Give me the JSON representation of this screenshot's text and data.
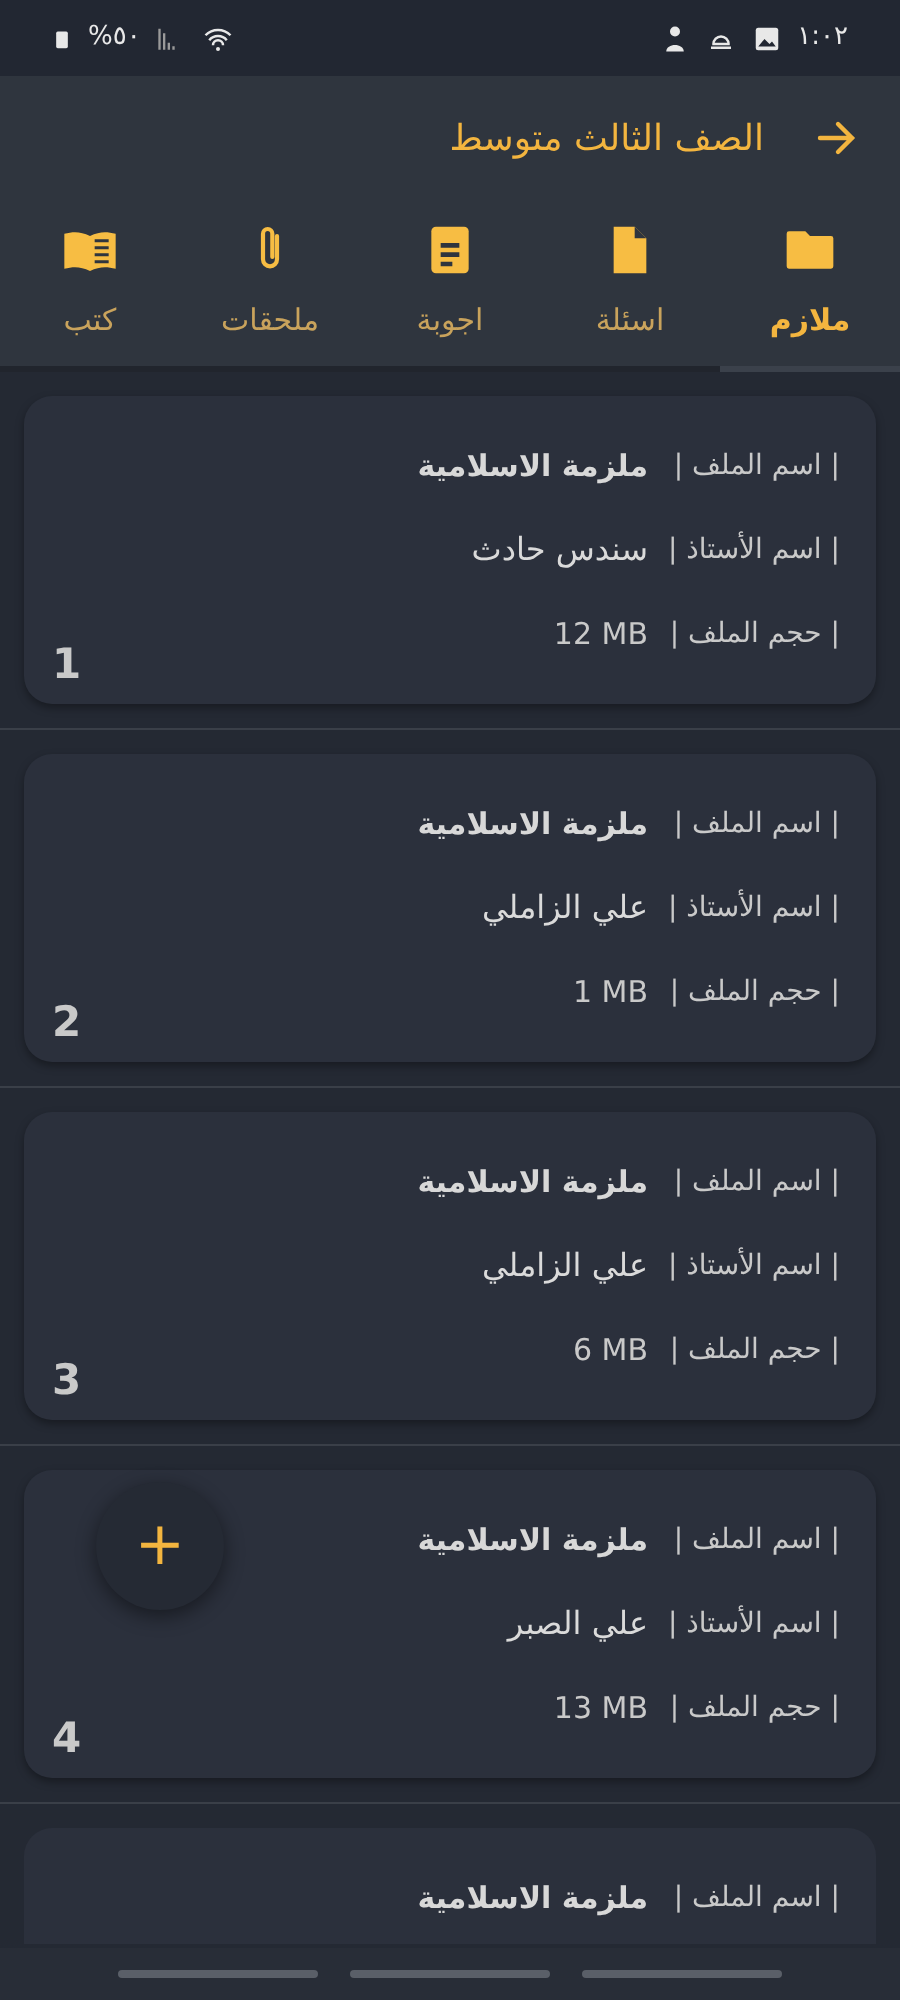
{
  "status_bar": {
    "time": "١:٠٢",
    "battery": "%٥٠"
  },
  "app_bar": {
    "title": "الصف الثالث متوسط"
  },
  "tabs": [
    {
      "label": "ملازم",
      "kind": "folder",
      "selected": true
    },
    {
      "label": "اسئلة",
      "kind": "file",
      "selected": false
    },
    {
      "label": "اجوبة",
      "kind": "document",
      "selected": false
    },
    {
      "label": "ملحقات",
      "kind": "paperclip",
      "selected": false
    },
    {
      "label": "كتب",
      "kind": "book",
      "selected": false
    }
  ],
  "files": [
    {
      "number": "1",
      "fields": [
        {
          "label": "| اسم الملف |",
          "value": "ملزمة الاسلامية",
          "kind": "name"
        },
        {
          "label": "| اسم الأستاذ |",
          "value": "سندس حادث",
          "kind": "teacher"
        },
        {
          "label": "| حجم الملف |",
          "value": "12 MB",
          "kind": "size"
        }
      ]
    },
    {
      "number": "2",
      "fields": [
        {
          "label": "| اسم الملف |",
          "value": "ملزمة الاسلامية",
          "kind": "name"
        },
        {
          "label": "| اسم الأستاذ |",
          "value": "علي الزاملي",
          "kind": "teacher"
        },
        {
          "label": "| حجم الملف |",
          "value": "1 MB",
          "kind": "size"
        }
      ]
    },
    {
      "number": "3",
      "fields": [
        {
          "label": "| اسم الملف |",
          "value": "ملزمة الاسلامية",
          "kind": "name"
        },
        {
          "label": "| اسم الأستاذ |",
          "value": "علي الزاملي",
          "kind": "teacher"
        },
        {
          "label": "| حجم الملف |",
          "value": "6 MB",
          "kind": "size"
        }
      ]
    },
    {
      "number": "4",
      "fields": [
        {
          "label": "| اسم الملف |",
          "value": "ملزمة الاسلامية",
          "kind": "name"
        },
        {
          "label": "| اسم الأستاذ |",
          "value": "علي الصبر",
          "kind": "teacher"
        },
        {
          "label": "| حجم الملف |",
          "value": "13 MB",
          "kind": "size"
        }
      ]
    },
    {
      "fields": [
        {
          "label": "| اسم الملف |",
          "value": "ملزمة الاسلامية",
          "kind": "name"
        }
      ]
    }
  ],
  "fab": {
    "symbol": "+"
  }
}
